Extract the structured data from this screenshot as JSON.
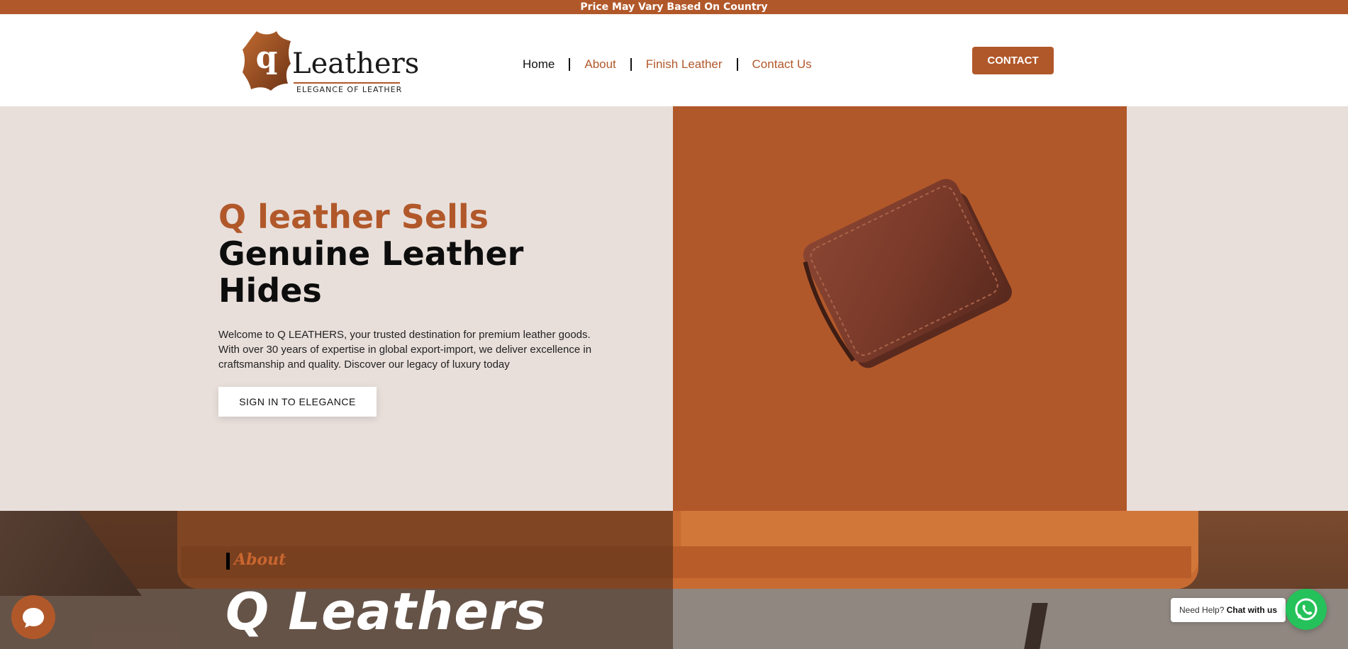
{
  "announcement": "Price May Vary Based On Country",
  "logo": {
    "mark_letter": "q",
    "name": "Leathers",
    "tagline": "ELEGANCE OF LEATHER"
  },
  "nav": {
    "items": [
      {
        "label": "Home",
        "active": true
      },
      {
        "label": "About",
        "active": false
      },
      {
        "label": "Finish Leather",
        "active": false
      },
      {
        "label": "Contact Us",
        "active": false
      }
    ]
  },
  "header": {
    "contact_label": "CONTACT"
  },
  "hero": {
    "title_accent": "Q leather Sells",
    "title_line2": "Genuine Leather",
    "title_line3": "Hides",
    "description": "Welcome to Q LEATHERS, your trusted destination for premium leather goods. With over 30 years of expertise in global export-import, we deliver excellence in craftsmanship and quality. Discover our legacy of luxury today",
    "cta_label": "SIGN IN TO ELEGANCE"
  },
  "about": {
    "label": "About",
    "title": "Q Leathers"
  },
  "chat_widget": {
    "help_text": "Need Help?",
    "help_strong": "Chat with us"
  },
  "colors": {
    "brand": "#b1582a",
    "hero_bg": "#e8dfdb",
    "whatsapp": "#25c15a"
  },
  "icons": {
    "chat": "chat-bubble-icon",
    "whatsapp": "whatsapp-icon",
    "wallet": "wallet-image"
  }
}
